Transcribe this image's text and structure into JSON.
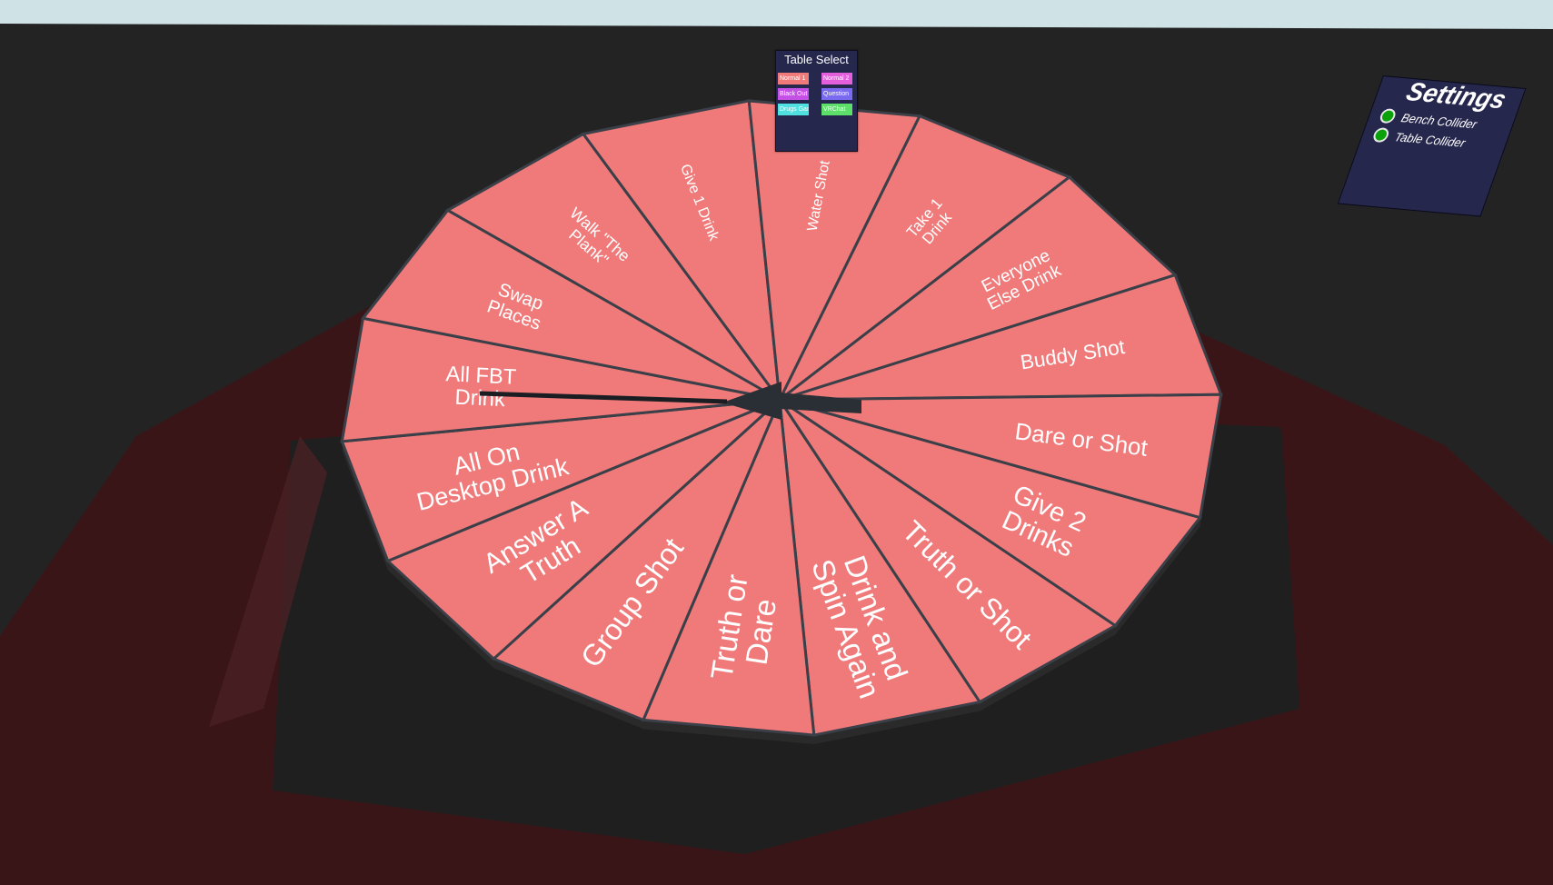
{
  "table_select": {
    "title": "Table Select",
    "buttons": [
      {
        "label": "Normal 1",
        "color": "#f07a7a"
      },
      {
        "label": "Normal 2",
        "color": "#e45fdc"
      },
      {
        "label": "Black Out",
        "color": "#c450e6"
      },
      {
        "label": "Question",
        "color": "#7a6af0"
      },
      {
        "label": "Drugs Game",
        "color": "#4fe0e0"
      },
      {
        "label": "VRChat",
        "color": "#5ce06a"
      }
    ]
  },
  "settings": {
    "title": "Settings",
    "toggles": [
      {
        "label": "Bench Collider",
        "color": "#0aa10a"
      },
      {
        "label": "Table Collider",
        "color": "#0aa10a"
      }
    ]
  },
  "wheel": {
    "segment_color": "#f07a7a",
    "segments": [
      {
        "lines": [
          "Walk \"The",
          "Plank\""
        ]
      },
      {
        "lines": [
          "Give 1 Drink"
        ]
      },
      {
        "lines": [
          "Water Shot"
        ]
      },
      {
        "lines": [
          "Take 1",
          "Drink"
        ]
      },
      {
        "lines": [
          "Everyone",
          "Else Drink"
        ]
      },
      {
        "lines": [
          "Buddy Shot"
        ]
      },
      {
        "lines": [
          "Dare or Shot"
        ]
      },
      {
        "lines": [
          "Give 2",
          "Drinks"
        ]
      },
      {
        "lines": [
          "Truth or Shot"
        ]
      },
      {
        "lines": [
          "Drink and",
          "Spin Again"
        ]
      },
      {
        "lines": [
          "Truth or",
          "Dare"
        ]
      },
      {
        "lines": [
          "Group Shot"
        ]
      },
      {
        "lines": [
          "Answer A",
          "Truth"
        ]
      },
      {
        "lines": [
          "All On",
          "Desktop Drink"
        ]
      },
      {
        "lines": [
          "All FBT",
          "Drink"
        ]
      },
      {
        "lines": [
          "Swap",
          "Places"
        ]
      }
    ]
  }
}
